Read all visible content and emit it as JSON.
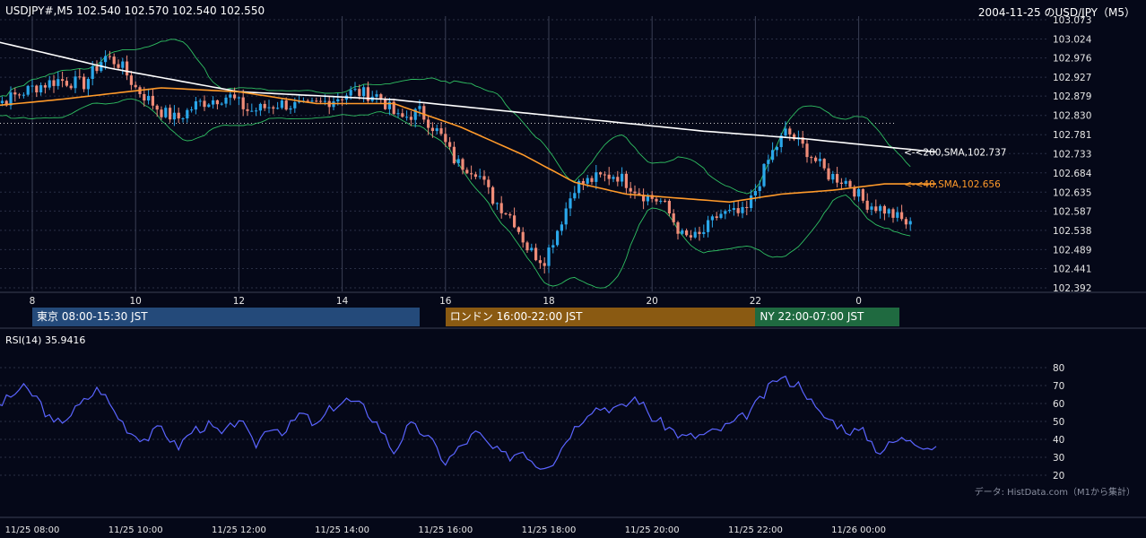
{
  "header": {
    "symbol_ohlc": "USDJPY#,M5 102.540 102.570 102.540 102.550",
    "title_right": "2004-11-25 のUSD/JPY（M5）"
  },
  "colors": {
    "background": "#050818",
    "candle_up": "#2aa7ea",
    "candle_down": "#f08c78",
    "sma200": "#ffffff",
    "sma40": "#ff9a2a",
    "bollinger": "#2fbf62",
    "rsi_line": "#5a64ff",
    "grid": "#2a2f45",
    "session_tokyo": "#244a7a",
    "session_london": "#8a5a12",
    "session_ny": "#1f6a40"
  },
  "chart_data": [
    {
      "type": "candlestick",
      "timeframe": "M5",
      "ylim": [
        102.392,
        103.073
      ],
      "y_ticks": [
        "103.073",
        "103.024",
        "102.976",
        "102.927",
        "102.879",
        "102.830",
        "102.781",
        "102.733",
        "102.684",
        "102.635",
        "102.587",
        "102.538",
        "102.489",
        "102.441",
        "102.392"
      ],
      "x_ticks": [
        "8",
        "10",
        "12",
        "14",
        "16",
        "18",
        "20",
        "22",
        "0"
      ],
      "x_tick_hours": [
        8,
        10,
        12,
        14,
        16,
        18,
        20,
        22,
        24
      ],
      "x_range_hours": [
        6.9,
        25.5
      ],
      "reference_level": 102.81,
      "annotations": [
        {
          "label": "<-<200,SMA,102.737",
          "value": 102.737,
          "color": "#ffffff"
        },
        {
          "label": "<-<40,SMA,102.656",
          "value": 102.656,
          "color": "#ff9a2a"
        }
      ],
      "key_points": [
        {
          "t": 7.0,
          "v": 102.85
        },
        {
          "t": 7.5,
          "v": 102.87
        },
        {
          "t": 8.0,
          "v": 102.9
        },
        {
          "t": 8.5,
          "v": 102.92
        },
        {
          "t": 9.0,
          "v": 102.91
        },
        {
          "t": 9.4,
          "v": 102.98
        },
        {
          "t": 9.7,
          "v": 102.96
        },
        {
          "t": 10.0,
          "v": 102.9
        },
        {
          "t": 10.5,
          "v": 102.84
        },
        {
          "t": 10.8,
          "v": 102.82
        },
        {
          "t": 11.2,
          "v": 102.86
        },
        {
          "t": 11.8,
          "v": 102.88
        },
        {
          "t": 12.2,
          "v": 102.84
        },
        {
          "t": 12.8,
          "v": 102.86
        },
        {
          "t": 13.3,
          "v": 102.85
        },
        {
          "t": 13.8,
          "v": 102.87
        },
        {
          "t": 14.2,
          "v": 102.89
        },
        {
          "t": 14.7,
          "v": 102.88
        },
        {
          "t": 15.1,
          "v": 102.82
        },
        {
          "t": 15.5,
          "v": 102.84
        },
        {
          "t": 15.9,
          "v": 102.78
        },
        {
          "t": 16.2,
          "v": 102.71
        },
        {
          "t": 16.6,
          "v": 102.69
        },
        {
          "t": 16.9,
          "v": 102.62
        },
        {
          "t": 17.3,
          "v": 102.57
        },
        {
          "t": 17.6,
          "v": 102.49
        },
        {
          "t": 17.9,
          "v": 102.46
        },
        {
          "t": 18.2,
          "v": 102.55
        },
        {
          "t": 18.5,
          "v": 102.65
        },
        {
          "t": 18.9,
          "v": 102.67
        },
        {
          "t": 19.3,
          "v": 102.68
        },
        {
          "t": 19.8,
          "v": 102.63
        },
        {
          "t": 20.2,
          "v": 102.61
        },
        {
          "t": 20.6,
          "v": 102.52
        },
        {
          "t": 20.9,
          "v": 102.52
        },
        {
          "t": 21.3,
          "v": 102.58
        },
        {
          "t": 21.8,
          "v": 102.58
        },
        {
          "t": 22.0,
          "v": 102.64
        },
        {
          "t": 22.3,
          "v": 102.73
        },
        {
          "t": 22.6,
          "v": 102.79
        },
        {
          "t": 23.0,
          "v": 102.74
        },
        {
          "t": 23.4,
          "v": 102.68
        },
        {
          "t": 23.8,
          "v": 102.66
        },
        {
          "t": 24.1,
          "v": 102.61
        },
        {
          "t": 24.5,
          "v": 102.59
        },
        {
          "t": 25.0,
          "v": 102.55
        }
      ],
      "sma200_points": [
        {
          "t": 6.9,
          "v": 103.03
        },
        {
          "t": 9.5,
          "v": 102.95
        },
        {
          "t": 12.0,
          "v": 102.89
        },
        {
          "t": 15.0,
          "v": 102.87
        },
        {
          "t": 18.0,
          "v": 102.83
        },
        {
          "t": 21.0,
          "v": 102.79
        },
        {
          "t": 23.0,
          "v": 102.77
        },
        {
          "t": 25.5,
          "v": 102.737
        }
      ],
      "sma40_points": [
        {
          "t": 6.9,
          "v": 102.85
        },
        {
          "t": 8.5,
          "v": 102.87
        },
        {
          "t": 10.5,
          "v": 102.9
        },
        {
          "t": 12.0,
          "v": 102.89
        },
        {
          "t": 13.5,
          "v": 102.86
        },
        {
          "t": 15.0,
          "v": 102.86
        },
        {
          "t": 16.3,
          "v": 102.8
        },
        {
          "t": 17.5,
          "v": 102.73
        },
        {
          "t": 18.5,
          "v": 102.66
        },
        {
          "t": 19.5,
          "v": 102.63
        },
        {
          "t": 20.5,
          "v": 102.62
        },
        {
          "t": 21.5,
          "v": 102.61
        },
        {
          "t": 22.5,
          "v": 102.63
        },
        {
          "t": 23.5,
          "v": 102.64
        },
        {
          "t": 24.5,
          "v": 102.656
        },
        {
          "t": 25.5,
          "v": 102.656
        }
      ]
    },
    {
      "type": "line",
      "title": "RSI(14) 35.9416",
      "ylim": [
        15,
        85
      ],
      "y_ticks": [
        80,
        70,
        60,
        50,
        40,
        30,
        20
      ],
      "x_ticks": [
        "11/25 08:00",
        "11/25 10:00",
        "11/25 12:00",
        "11/25 14:00",
        "11/25 16:00",
        "11/25 18:00",
        "11/25 20:00",
        "11/25 22:00",
        "11/26 00:00"
      ],
      "x_tick_hours": [
        8,
        10,
        12,
        14,
        16,
        18,
        20,
        22,
        24
      ],
      "key_points": [
        {
          "t": 7.0,
          "v": 40
        },
        {
          "t": 7.2,
          "v": 56
        },
        {
          "t": 7.5,
          "v": 62
        },
        {
          "t": 7.8,
          "v": 69
        },
        {
          "t": 8.1,
          "v": 63
        },
        {
          "t": 8.4,
          "v": 48
        },
        {
          "t": 8.7,
          "v": 53
        },
        {
          "t": 9.0,
          "v": 61
        },
        {
          "t": 9.3,
          "v": 69
        },
        {
          "t": 9.6,
          "v": 55
        },
        {
          "t": 9.9,
          "v": 44
        },
        {
          "t": 10.2,
          "v": 40
        },
        {
          "t": 10.5,
          "v": 47
        },
        {
          "t": 10.8,
          "v": 35
        },
        {
          "t": 11.1,
          "v": 45
        },
        {
          "t": 11.4,
          "v": 48
        },
        {
          "t": 11.7,
          "v": 42
        },
        {
          "t": 12.0,
          "v": 52
        },
        {
          "t": 12.3,
          "v": 36
        },
        {
          "t": 12.6,
          "v": 48
        },
        {
          "t": 12.9,
          "v": 44
        },
        {
          "t": 13.2,
          "v": 55
        },
        {
          "t": 13.5,
          "v": 47
        },
        {
          "t": 13.8,
          "v": 58
        },
        {
          "t": 14.1,
          "v": 62
        },
        {
          "t": 14.4,
          "v": 58
        },
        {
          "t": 14.7,
          "v": 48
        },
        {
          "t": 15.0,
          "v": 33
        },
        {
          "t": 15.3,
          "v": 48
        },
        {
          "t": 15.6,
          "v": 43
        },
        {
          "t": 15.8,
          "v": 36
        },
        {
          "t": 16.0,
          "v": 27
        },
        {
          "t": 16.3,
          "v": 36
        },
        {
          "t": 16.6,
          "v": 44
        },
        {
          "t": 16.9,
          "v": 35
        },
        {
          "t": 17.2,
          "v": 30
        },
        {
          "t": 17.5,
          "v": 34
        },
        {
          "t": 17.8,
          "v": 25
        },
        {
          "t": 18.1,
          "v": 28
        },
        {
          "t": 18.4,
          "v": 43
        },
        {
          "t": 18.8,
          "v": 57
        },
        {
          "t": 19.1,
          "v": 58
        },
        {
          "t": 19.4,
          "v": 57
        },
        {
          "t": 19.7,
          "v": 64
        },
        {
          "t": 20.0,
          "v": 52
        },
        {
          "t": 20.3,
          "v": 47
        },
        {
          "t": 20.6,
          "v": 41
        },
        {
          "t": 20.9,
          "v": 42
        },
        {
          "t": 21.2,
          "v": 44
        },
        {
          "t": 21.5,
          "v": 48
        },
        {
          "t": 21.8,
          "v": 53
        },
        {
          "t": 22.1,
          "v": 62
        },
        {
          "t": 22.4,
          "v": 74
        },
        {
          "t": 22.6,
          "v": 73
        },
        {
          "t": 22.9,
          "v": 70
        },
        {
          "t": 23.2,
          "v": 55
        },
        {
          "t": 23.5,
          "v": 50
        },
        {
          "t": 23.8,
          "v": 45
        },
        {
          "t": 24.1,
          "v": 44
        },
        {
          "t": 24.4,
          "v": 33
        },
        {
          "t": 24.7,
          "v": 39
        },
        {
          "t": 25.0,
          "v": 41
        },
        {
          "t": 25.3,
          "v": 36
        },
        {
          "t": 25.5,
          "v": 35.94
        }
      ]
    }
  ],
  "sessions": [
    {
      "label": "東京 08:00-15:30 JST",
      "start_hour": 8,
      "end_hour": 15.5
    },
    {
      "label": "ロンドン 16:00-22:00 JST",
      "start_hour": 16,
      "end_hour": 22
    },
    {
      "label": "NY 22:00-07:00 JST",
      "start_hour": 22,
      "end_hour": 25.55
    }
  ],
  "footer": {
    "source": "データ: HistData.com（M1から集計）"
  }
}
